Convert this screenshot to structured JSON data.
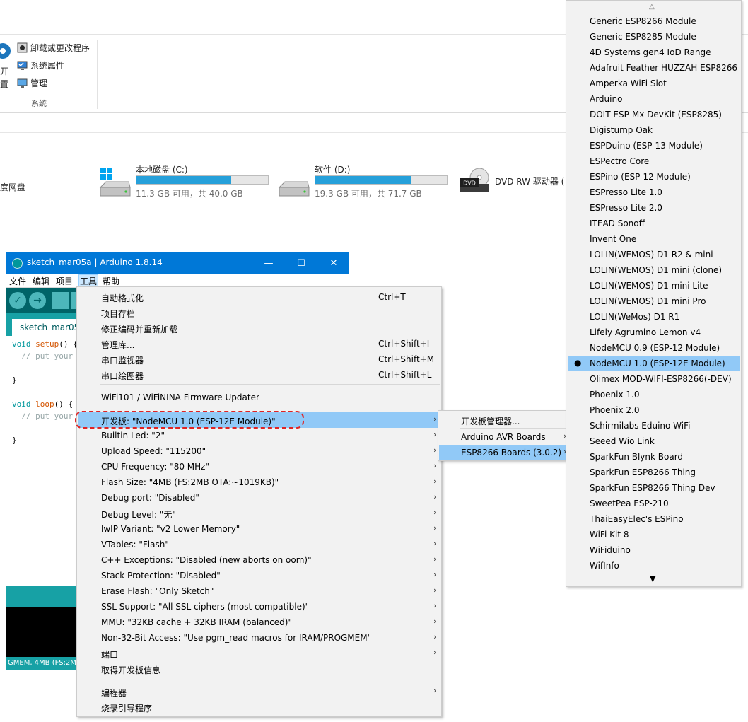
{
  "explorer": {
    "ribbon": {
      "big_button_lines": [
        "开",
        "置"
      ],
      "items": [
        {
          "label": "卸载或更改程序",
          "icon": "uninstall-icon"
        },
        {
          "label": "系统属性",
          "icon": "system-properties-icon"
        },
        {
          "label": "管理",
          "icon": "computer-management-icon"
        }
      ],
      "group_label": "系统"
    },
    "left_fragment": "度网盘",
    "drives": [
      {
        "name": "本地磁盘 (C:)",
        "info": "11.3 GB 可用，共 40.0 GB",
        "used_fraction": 0.72,
        "icon": "windows-drive-icon"
      },
      {
        "name": "软件 (D:)",
        "info": "19.3 GB 可用，共 71.7 GB",
        "used_fraction": 0.73,
        "icon": "hard-drive-icon"
      },
      {
        "name": "DVD RW 驱动器 (",
        "info": "",
        "icon": "dvd-drive-icon",
        "badge": "DVD"
      }
    ]
  },
  "ide": {
    "title": "sketch_mar05a | Arduino 1.8.14",
    "window_buttons": {
      "minimize": "—",
      "maximize": "☐",
      "close": "✕"
    },
    "menus": [
      "文件",
      "编辑",
      "项目",
      "工具",
      "帮助"
    ],
    "active_menu": "工具",
    "tab": "sketch_mar05",
    "code": [
      {
        "pre": "",
        "kw": "void",
        "mid": " ",
        "fn": "setup",
        "post": "() {",
        "cm": ""
      },
      {
        "pre": "  ",
        "kw": "",
        "mid": "",
        "fn": "",
        "post": "",
        "cm": "// put your"
      },
      {
        "pre": "",
        "kw": "",
        "mid": "",
        "fn": "",
        "post": "",
        "cm": ""
      },
      {
        "pre": "}",
        "kw": "",
        "mid": "",
        "fn": "",
        "post": "",
        "cm": ""
      },
      {
        "pre": "",
        "kw": "",
        "mid": "",
        "fn": "",
        "post": "",
        "cm": ""
      },
      {
        "pre": "",
        "kw": "void",
        "mid": " ",
        "fn": "loop",
        "post": "() {",
        "cm": ""
      },
      {
        "pre": "  ",
        "kw": "",
        "mid": "",
        "fn": "",
        "post": "",
        "cm": "// put your"
      },
      {
        "pre": "",
        "kw": "",
        "mid": "",
        "fn": "",
        "post": "",
        "cm": ""
      },
      {
        "pre": "}",
        "kw": "",
        "mid": "",
        "fn": "",
        "post": "",
        "cm": ""
      }
    ],
    "status_bottom": "GMEM, 4MB (FS:2M",
    "colors": {
      "title_bar": "#0078d7",
      "toolbar": "#006468",
      "accent": "#17a1a5"
    }
  },
  "tools_menu": {
    "items": [
      {
        "label": "自动格式化",
        "shortcut": "Ctrl+T",
        "arrow": false
      },
      {
        "label": "项目存档",
        "shortcut": "",
        "arrow": false
      },
      {
        "label": "修正编码并重新加载",
        "shortcut": "",
        "arrow": false
      },
      {
        "label": "管理库...",
        "shortcut": "Ctrl+Shift+I",
        "arrow": false
      },
      {
        "label": "串口监视器",
        "shortcut": "Ctrl+Shift+M",
        "arrow": false
      },
      {
        "label": "串口绘图器",
        "shortcut": "Ctrl+Shift+L",
        "arrow": false
      },
      {
        "label": "WiFi101 / WiFiNINA Firmware Updater",
        "shortcut": "",
        "arrow": false
      },
      {
        "label": "开发板: \"NodeMCU 1.0 (ESP-12E Module)\"",
        "shortcut": "",
        "arrow": true,
        "highlighted": true
      },
      {
        "label": "Builtin Led: \"2\"",
        "shortcut": "",
        "arrow": true
      },
      {
        "label": "Upload Speed: \"115200\"",
        "shortcut": "",
        "arrow": true
      },
      {
        "label": "CPU Frequency: \"80 MHz\"",
        "shortcut": "",
        "arrow": true
      },
      {
        "label": "Flash Size: \"4MB (FS:2MB OTA:~1019KB)\"",
        "shortcut": "",
        "arrow": true
      },
      {
        "label": "Debug port: \"Disabled\"",
        "shortcut": "",
        "arrow": true
      },
      {
        "label": "Debug Level: \"无\"",
        "shortcut": "",
        "arrow": true
      },
      {
        "label": "lwIP Variant: \"v2 Lower Memory\"",
        "shortcut": "",
        "arrow": true
      },
      {
        "label": "VTables: \"Flash\"",
        "shortcut": "",
        "arrow": true
      },
      {
        "label": "C++ Exceptions: \"Disabled (new aborts on oom)\"",
        "shortcut": "",
        "arrow": true
      },
      {
        "label": "Stack Protection: \"Disabled\"",
        "shortcut": "",
        "arrow": true
      },
      {
        "label": "Erase Flash: \"Only Sketch\"",
        "shortcut": "",
        "arrow": true
      },
      {
        "label": "SSL Support: \"All SSL ciphers (most compatible)\"",
        "shortcut": "",
        "arrow": true
      },
      {
        "label": "MMU: \"32KB cache + 32KB IRAM (balanced)\"",
        "shortcut": "",
        "arrow": true
      },
      {
        "label": "Non-32-Bit Access: \"Use pgm_read macros for IRAM/PROGMEM\"",
        "shortcut": "",
        "arrow": true
      },
      {
        "label": "端口",
        "shortcut": "",
        "arrow": true
      },
      {
        "label": "取得开发板信息",
        "shortcut": "",
        "arrow": false
      },
      {
        "label": "编程器",
        "shortcut": "",
        "arrow": true
      },
      {
        "label": "烧录引导程序",
        "shortcut": "",
        "arrow": false
      }
    ],
    "arrow_glyph": "›"
  },
  "board_submenu": {
    "items": [
      {
        "label": "开发板管理器...",
        "arrow": false
      },
      {
        "label": "Arduino AVR Boards",
        "arrow": true
      },
      {
        "label": "ESP8266 Boards (3.0.2)",
        "arrow": true,
        "highlighted": true
      }
    ]
  },
  "board_list": {
    "scroll_up": "△",
    "scroll_down": "▼",
    "selected_marker": "●",
    "items": [
      "Generic ESP8266 Module",
      "Generic ESP8285 Module",
      "4D Systems gen4 IoD Range",
      "Adafruit Feather HUZZAH ESP8266",
      "Amperka WiFi Slot",
      "Arduino",
      "DOIT ESP-Mx DevKit (ESP8285)",
      "Digistump Oak",
      "ESPDuino (ESP-13 Module)",
      "ESPectro Core",
      "ESPino (ESP-12 Module)",
      "ESPresso Lite 1.0",
      "ESPresso Lite 2.0",
      "ITEAD Sonoff",
      "Invent One",
      "LOLIN(WEMOS) D1 R2 & mini",
      "LOLIN(WEMOS) D1 mini (clone)",
      "LOLIN(WEMOS) D1 mini Lite",
      "LOLIN(WEMOS) D1 mini Pro",
      "LOLIN(WeMos) D1 R1",
      "Lifely Agrumino Lemon v4",
      "NodeMCU 0.9 (ESP-12 Module)",
      "NodeMCU 1.0 (ESP-12E Module)",
      "Olimex MOD-WIFI-ESP8266(-DEV)",
      "Phoenix 1.0",
      "Phoenix 2.0",
      "Schirmilabs Eduino WiFi",
      "Seeed Wio Link",
      "SparkFun Blynk Board",
      "SparkFun ESP8266 Thing",
      "SparkFun ESP8266 Thing Dev",
      "SweetPea ESP-210",
      "ThaiEasyElec's ESPino",
      "WiFi Kit 8",
      "WiFiduino",
      "WifInfo"
    ],
    "selected": "NodeMCU 1.0 (ESP-12E Module)"
  }
}
